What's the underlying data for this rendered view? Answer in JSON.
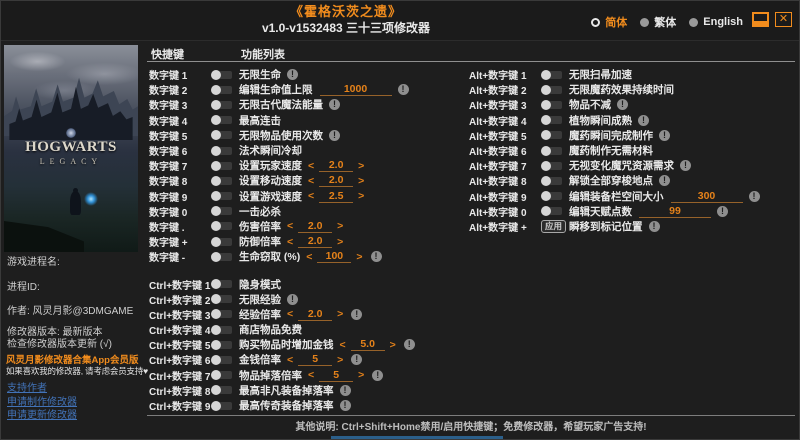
{
  "window": {
    "title": "《霍格沃茨之遗》",
    "subtitle": "v1.0-v1532483 三十三项修改器",
    "languages": [
      {
        "label": "简体",
        "selected": true
      },
      {
        "label": "繁体",
        "selected": false
      },
      {
        "label": "English",
        "selected": false
      }
    ]
  },
  "icons": {
    "warning": "!",
    "decrement": "<",
    "increment": ">",
    "close": "✕"
  },
  "colors": {
    "accent_orange": "#f18c1d",
    "value_orange": "#e5821a",
    "link_blue": "#4273b8",
    "background": "#1e1e1e"
  },
  "sidebar": {
    "cover_title_line1": "HOGWARTS",
    "cover_title_line2": "LEGACY",
    "process_name_label": "游戏进程名:",
    "process_id_label": "进程ID:",
    "author": "作者: 风灵月影@3DMGAME",
    "version": "修改器版本: 最新版本",
    "check_update": "检查修改器版本更新 (√)",
    "promo_title": "风灵月影修改器合集App会员版",
    "promo_note": "如果喜欢我的修改器, 请考虑会员支持♥",
    "links": [
      {
        "label": "支持作者"
      },
      {
        "label": "申请制作修改器"
      },
      {
        "label": "申请更新修改器"
      }
    ]
  },
  "table": {
    "hotkey_header": "快捷键",
    "function_header": "功能列表",
    "left_rows": [
      {
        "hotkey": "数字键 1",
        "label": "无限生命",
        "warning": true
      },
      {
        "hotkey": "数字键 2",
        "label": "编辑生命值上限",
        "input": "1000",
        "warning": true
      },
      {
        "hotkey": "数字键 3",
        "label": "无限古代魔法能量",
        "warning": true
      },
      {
        "hotkey": "数字键 4",
        "label": "最高连击"
      },
      {
        "hotkey": "数字键 5",
        "label": "无限物品使用次数",
        "warning": true
      },
      {
        "hotkey": "数字键 6",
        "label": "法术瞬间冷却"
      },
      {
        "hotkey": "数字键 7",
        "label": "设置玩家速度",
        "spinner": "2.0"
      },
      {
        "hotkey": "数字键 8",
        "label": "设置移动速度",
        "spinner": "2.0"
      },
      {
        "hotkey": "数字键 9",
        "label": "设置游戏速度",
        "spinner": "2.5"
      },
      {
        "hotkey": "数字键 0",
        "label": "一击必杀"
      },
      {
        "hotkey": "数字键 .",
        "label": "伤害倍率",
        "spinner": "2.0"
      },
      {
        "hotkey": "数字键 +",
        "label": "防御倍率",
        "spinner": "2.0"
      },
      {
        "hotkey": "数字键 -",
        "label": "生命窃取 (%)",
        "spinner": "100",
        "warning": true
      },
      {
        "hotkey": "Ctrl+数字键 1",
        "label": "隐身模式",
        "gap": true
      },
      {
        "hotkey": "Ctrl+数字键 2",
        "label": "无限经验",
        "warning": true
      },
      {
        "hotkey": "Ctrl+数字键 3",
        "label": "经验倍率",
        "spinner": "2.0",
        "warning": true
      },
      {
        "hotkey": "Ctrl+数字键 4",
        "label": "商店物品免费"
      },
      {
        "hotkey": "Ctrl+数字键 5",
        "label": "购买物品时增加金钱",
        "spinner": "5.0",
        "warning": true
      },
      {
        "hotkey": "Ctrl+数字键 6",
        "label": "金钱倍率",
        "spinner": "5",
        "warning": true
      },
      {
        "hotkey": "Ctrl+数字键 7",
        "label": "物品掉落倍率",
        "spinner": "5",
        "warning": true
      },
      {
        "hotkey": "Ctrl+数字键 8",
        "label": "最高非凡装备掉落率",
        "warning": true
      },
      {
        "hotkey": "Ctrl+数字键 9",
        "label": "最高传奇装备掉落率",
        "warning": true
      }
    ],
    "right_rows": [
      {
        "hotkey": "Alt+数字键 1",
        "label": "无限扫帚加速"
      },
      {
        "hotkey": "Alt+数字键 2",
        "label": "无限魔药效果持续时间"
      },
      {
        "hotkey": "Alt+数字键 3",
        "label": "物品不减",
        "warning": true
      },
      {
        "hotkey": "Alt+数字键 4",
        "label": "植物瞬间成熟",
        "warning": true
      },
      {
        "hotkey": "Alt+数字键 5",
        "label": "魔药瞬间完成制作",
        "warning": true
      },
      {
        "hotkey": "Alt+数字键 6",
        "label": "魔药制作无需材料"
      },
      {
        "hotkey": "Alt+数字键 7",
        "label": "无视变化魔咒资源需求",
        "warning": true
      },
      {
        "hotkey": "Alt+数字键 8",
        "label": "解锁全部穿梭地点",
        "warning": true
      },
      {
        "hotkey": "Alt+数字键 9",
        "label": "编辑装备栏空间大小",
        "input": "300",
        "warning": true
      },
      {
        "hotkey": "Alt+数字键 0",
        "label": "编辑天赋点数",
        "input": "99",
        "warning": true
      },
      {
        "hotkey": "Alt+数字键 +",
        "label": "瞬移到标记位置",
        "control": "apply",
        "apply_label": "应用",
        "warning": true
      }
    ]
  },
  "statusbar": {
    "text": "其他说明: Ctrl+Shift+Home禁用/启用快捷键；免费修改器，希望玩家广告支持!"
  }
}
